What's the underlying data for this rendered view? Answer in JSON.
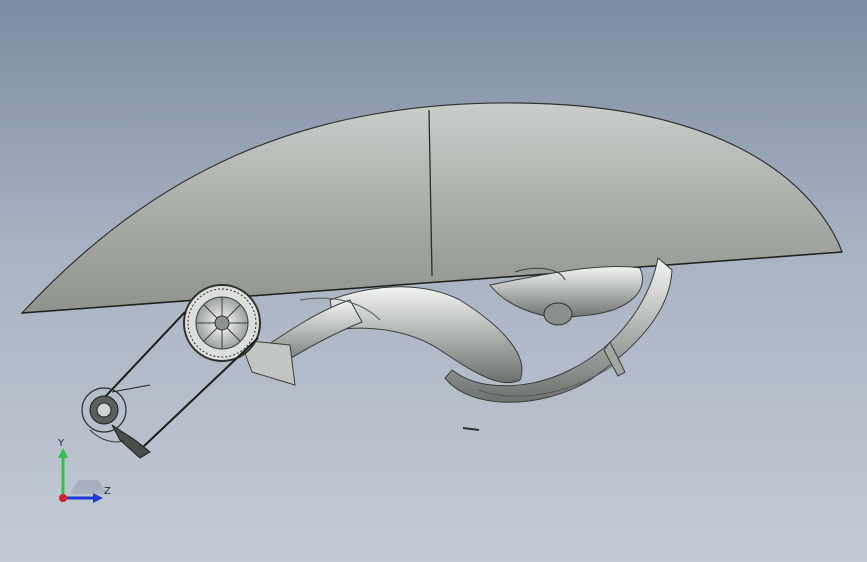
{
  "viewport": {
    "background_top": "#7d8ca3",
    "background_bottom": "#c3cad4"
  },
  "triad": {
    "y_label": "Y",
    "z_label": "Z",
    "y_color": "#2ec24a",
    "z_color": "#1f3ad8",
    "x_color": "#d42020"
  }
}
